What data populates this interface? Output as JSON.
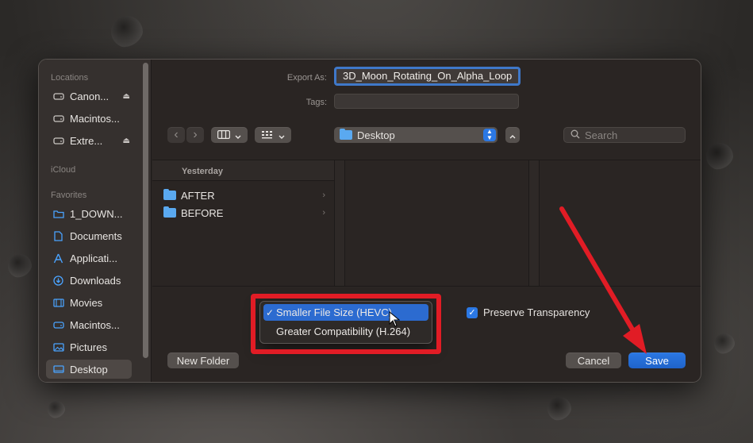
{
  "sidebar": {
    "sections": [
      {
        "heading": "Locations",
        "items": [
          {
            "label": "Canon...",
            "icon": "drive-icon",
            "eject": "⏏"
          },
          {
            "label": "Macintos...",
            "icon": "drive-icon"
          },
          {
            "label": "Extre...",
            "icon": "drive-icon",
            "eject": "⏏"
          }
        ]
      },
      {
        "heading": "iCloud",
        "items": []
      },
      {
        "heading": "Favorites",
        "items": [
          {
            "label": "1_DOWN...",
            "icon": "folder-icon"
          },
          {
            "label": "Documents",
            "icon": "document-icon"
          },
          {
            "label": "Applicati...",
            "icon": "applications-icon"
          },
          {
            "label": "Downloads",
            "icon": "download-icon"
          },
          {
            "label": "Movies",
            "icon": "film-icon"
          },
          {
            "label": "Macintos...",
            "icon": "drive-icon"
          },
          {
            "label": "Pictures",
            "icon": "picture-icon"
          },
          {
            "label": "Desktop",
            "icon": "desktop-icon",
            "selected": true
          }
        ]
      }
    ]
  },
  "form": {
    "export_label": "Export As:",
    "export_value": "3D_Moon_Rotating_On_Alpha_Loop",
    "tags_label": "Tags:",
    "tags_value": ""
  },
  "toolbar": {
    "back_icon": "‹",
    "forward_icon": "›",
    "location": "Desktop",
    "search_placeholder": "Search"
  },
  "browser": {
    "group_heading": "Yesterday",
    "rows": [
      {
        "label": "AFTER"
      },
      {
        "label": "BEFORE"
      }
    ]
  },
  "format_popup": {
    "options": [
      {
        "label": "Smaller File Size (HEVC)",
        "selected": true
      },
      {
        "label": "Greater Compatibility (H.264)",
        "selected": false
      }
    ]
  },
  "options": {
    "preserve_transparency_label": "Preserve Transparency",
    "preserve_transparency_checked": true
  },
  "buttons": {
    "new_folder": "New Folder",
    "cancel": "Cancel",
    "save": "Save"
  },
  "colors": {
    "accent": "#2b78e4",
    "annotation": "#e11c25"
  }
}
